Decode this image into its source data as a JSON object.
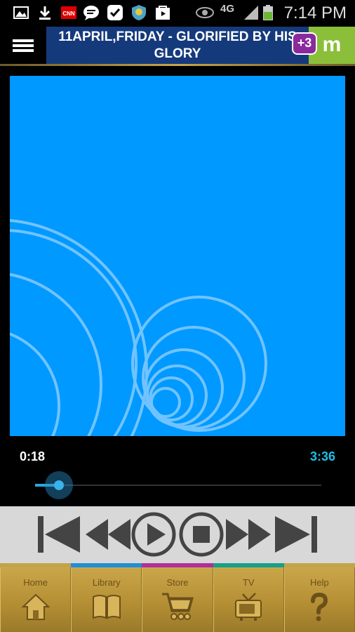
{
  "status_bar": {
    "time": "7:14 PM",
    "network": "4G",
    "icons": [
      "image-icon",
      "download-icon",
      "cnn-icon",
      "chat-icon",
      "check-icon",
      "shield-icon",
      "play-store-icon",
      "eye-icon",
      "signal-icon",
      "battery-icon"
    ]
  },
  "header": {
    "title": "11APRIL,FRIDAY  - GLORIFIED BY HIS GLORY",
    "app_logo": "m",
    "notification_badge": "+3"
  },
  "player": {
    "elapsed": "0:18",
    "duration": "3:36",
    "progress": 0.083
  },
  "transport": {
    "buttons": [
      "skip-previous-icon",
      "rewind-icon",
      "play-icon",
      "stop-icon",
      "fast-forward-icon",
      "skip-next-icon"
    ]
  },
  "color_strip": [
    "#c2a34a",
    "#1f8fd6",
    "#b02f9a",
    "#14a08a",
    "#c2a34a"
  ],
  "bottom_nav": {
    "items": [
      {
        "label": "Home",
        "icon": "home-icon"
      },
      {
        "label": "Library",
        "icon": "book-icon"
      },
      {
        "label": "Store",
        "icon": "cart-icon"
      },
      {
        "label": "TV",
        "icon": "tv-icon"
      },
      {
        "label": "Help",
        "icon": "question-icon"
      }
    ]
  },
  "colors": {
    "artwork_bg": "#0099ff",
    "title_bg": "#153a7c",
    "accent_time": "#18c1e6",
    "logo_bg": "#8bbf3a",
    "badge_bg": "#8a2a9c"
  }
}
